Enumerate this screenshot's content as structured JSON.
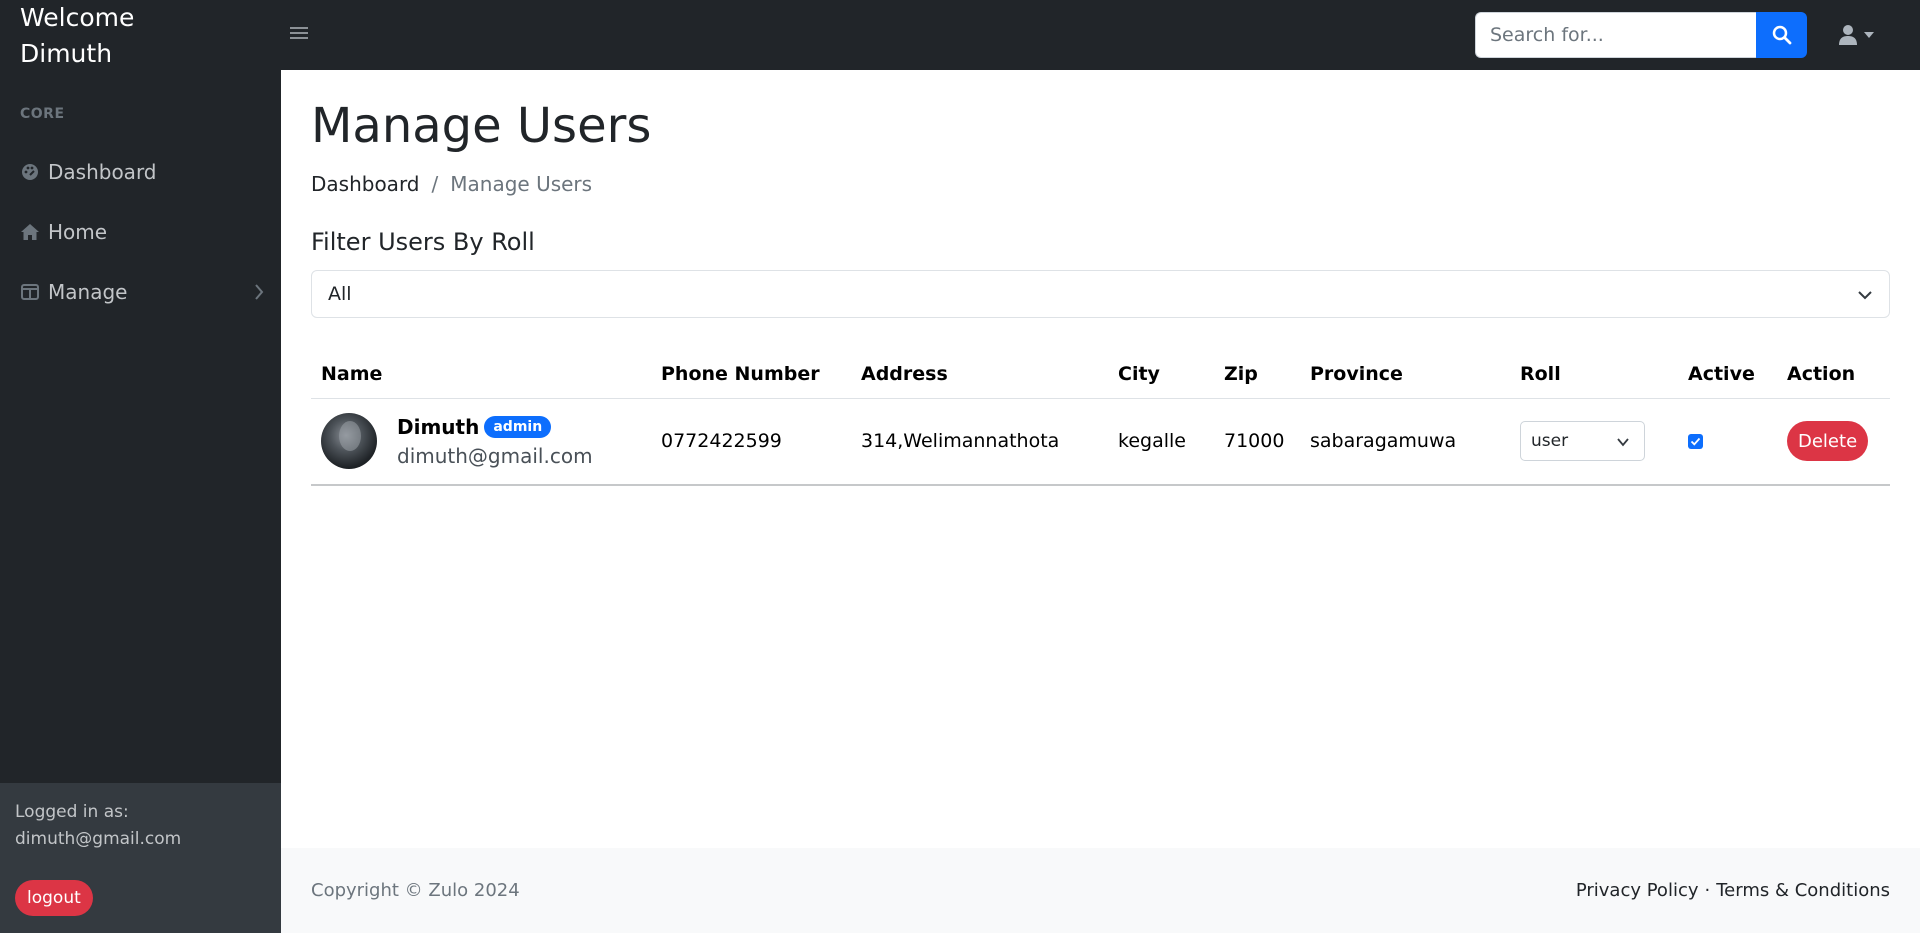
{
  "header": {
    "brand_line1": "Welcome",
    "brand_line2": "Dimuth",
    "search_placeholder": "Search for...",
    "icons": [
      "menu-toggle-icon",
      "search-icon",
      "user-icon",
      "caret-down-icon"
    ]
  },
  "sidebar": {
    "heading": "CORE",
    "items": [
      {
        "label": "Dashboard",
        "icon": "dashboard-icon"
      },
      {
        "label": "Home",
        "icon": "home-icon"
      },
      {
        "label": "Manage",
        "icon": "columns-icon"
      }
    ],
    "footer": {
      "logged_label": "Logged in as:",
      "email": "dimuth@gmail.com",
      "logout_label": "logout"
    }
  },
  "main": {
    "title": "Manage Users",
    "breadcrumb": {
      "link": "Dashboard",
      "separator": "/",
      "active": "Manage Users"
    },
    "filter": {
      "label": "Filter Users By Roll",
      "selected": "All"
    },
    "table": {
      "headers": [
        "Name",
        "Phone Number",
        "Address",
        "City",
        "Zip",
        "Province",
        "Roll",
        "Active",
        "Action"
      ],
      "rows": [
        {
          "name": "Dimuth",
          "badge": "admin",
          "email": "dimuth@gmail.com",
          "phone": "0772422599",
          "address": "314,Welimannathota",
          "city": "kegalle",
          "zip": "71000",
          "province": "sabaragamuwa",
          "roll": "user",
          "active": true,
          "action": "Delete"
        }
      ]
    }
  },
  "footer": {
    "copyright": "Copyright © Zulo 2024",
    "privacy": "Privacy Policy",
    "separator": "·",
    "terms": "Terms & Conditions"
  },
  "colors": {
    "dark": "#212529",
    "primary": "#0d6efd",
    "danger": "#dc3545",
    "footer_bg": "#f8f9fa"
  }
}
